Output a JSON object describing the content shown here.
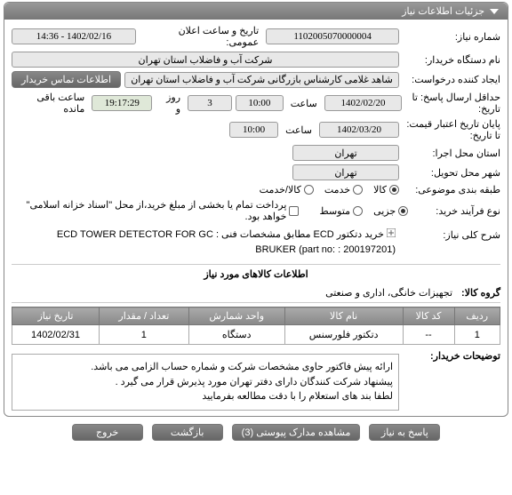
{
  "panel": {
    "title": "جزئیات اطلاعات نیاز"
  },
  "fields": {
    "need_no_label": "شماره نیاز:",
    "need_no": "1102005070000004",
    "announce_label": "تاریخ و ساعت اعلان عمومی:",
    "announce": "1402/02/16 - 14:36",
    "buyer_org_label": "نام دستگاه خریدار:",
    "buyer_org": "شرکت آب و فاضلاب استان تهران",
    "requester_label": "ایجاد کننده درخواست:",
    "requester": "شاهد غلامی کارشناس بازرگانی شرکت آب و فاضلاب استان تهران",
    "contact_btn": "اطلاعات تماس خریدار",
    "deadline_label": "حداقل ارسال پاسخ: تا تاریخ:",
    "deadline_date": "1402/02/20",
    "deadline_time": "10:00",
    "time_word": "ساعت",
    "days_val": "3",
    "days_and": "روز و",
    "countdown": "19:17:29",
    "remain": "ساعت باقی مانده",
    "valid_label": "پایان تاریخ اعتبار قیمت: تا تاریخ:",
    "valid_date": "1402/03/20",
    "valid_time": "10:00",
    "loc_exec_label": "استان محل اجرا:",
    "loc_exec": "تهران",
    "loc_deliver_label": "شهر محل تحویل:",
    "loc_deliver": "تهران",
    "cat_label": "طبقه بندی موضوعی:",
    "radios": {
      "goods": "کالا",
      "service": "خدمت",
      "both": "کالا/خدمت"
    },
    "proc_label": "نوع فرآیند خرید:",
    "proc_radios": {
      "retail": "جزیی",
      "medium": "متوسط"
    },
    "pay_note": "پرداخت تمام یا بخشی از مبلغ خرید،از محل \"اسناد خزانه اسلامی\" خواهد بود.",
    "need_title_label": "شرح کلی نیاز:",
    "need_title": "خرید   دتکتور ECD مطابق مشخصات فنی : ECD TOWER DETECTOR FOR GC BRUKER (part no: : 200197201)",
    "goods_section": "اطلاعات کالاهای مورد نیاز",
    "group_label": "گروه کالا:",
    "group_value": "تجهیزات خانگی، اداری و صنعتی",
    "desc_label": "توضیحات خریدار:",
    "desc_lines": [
      "ارائه پیش فاکتور حاوی مشخصات شرکت و شماره حساب الزامی می باشد.",
      "پیشنهاد شرکت کنندگان دارای دفتر تهران مورد پذیرش قرار می گیرد .",
      "لطفا بند های استعلام را با دقت مطالعه بفرمایید"
    ]
  },
  "table": {
    "headers": {
      "row": "ردیف",
      "code": "کد کالا",
      "name": "نام کالا",
      "unit": "واحد شمارش",
      "qty": "تعداد / مقدار",
      "date": "تاریخ نیاز"
    },
    "rows": [
      {
        "row": "1",
        "code": "--",
        "name": "دتکتور فلورسنس",
        "unit": "دستگاه",
        "qty": "1",
        "date": "1402/02/31"
      }
    ]
  },
  "footer": {
    "respond": "پاسخ به نیاز",
    "attachments": "مشاهده مدارک پیوستی  (3)",
    "back": "بازگشت",
    "exit": "خروج"
  }
}
